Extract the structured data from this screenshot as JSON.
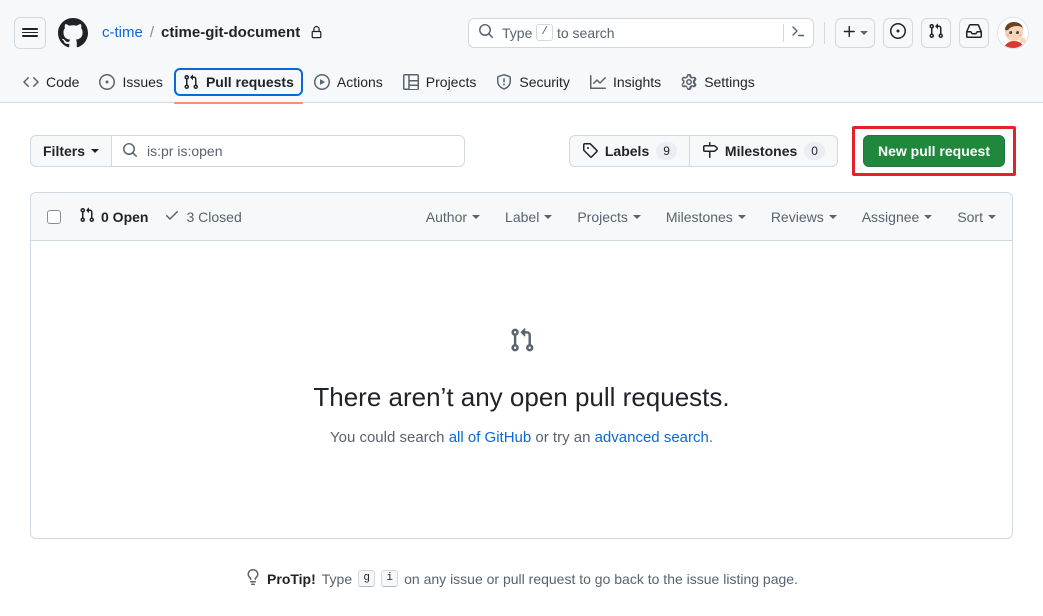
{
  "header": {
    "menu_label": "Open global navigation menu",
    "logo_name": "github-logo",
    "breadcrumb": {
      "owner": "c-time",
      "separator": "/",
      "repo": "ctime-git-document",
      "visibility_icon": "lock-icon"
    },
    "search": {
      "placeholder_before": "Type",
      "placeholder_key": "/",
      "placeholder_after": "to search",
      "terminal_icon": "command-palette-icon"
    },
    "actions": [
      {
        "name": "create-new-menu",
        "icon": "plus-icon",
        "has_caret": true
      },
      {
        "name": "issues-link",
        "icon": "issue-opened-icon"
      },
      {
        "name": "pull-requests-link",
        "icon": "git-pull-request-icon"
      },
      {
        "name": "notifications-inbox",
        "icon": "inbox-icon"
      }
    ],
    "avatar_alt": "user-avatar"
  },
  "nav": {
    "items": [
      {
        "label": "Code",
        "icon": "code-icon",
        "active": false
      },
      {
        "label": "Issues",
        "icon": "issue-opened-icon",
        "active": false
      },
      {
        "label": "Pull requests",
        "icon": "git-pull-request-icon",
        "active": true
      },
      {
        "label": "Actions",
        "icon": "play-icon",
        "active": false
      },
      {
        "label": "Projects",
        "icon": "table-icon",
        "active": false
      },
      {
        "label": "Security",
        "icon": "shield-icon",
        "active": false
      },
      {
        "label": "Insights",
        "icon": "graph-icon",
        "active": false
      },
      {
        "label": "Settings",
        "icon": "gear-icon",
        "active": false
      }
    ]
  },
  "toolbar": {
    "filters_label": "Filters",
    "query_value": "is:pr is:open",
    "search_icon": "search-icon",
    "labels_label": "Labels",
    "labels_count": "9",
    "labels_icon": "tag-icon",
    "milestones_label": "Milestones",
    "milestones_count": "0",
    "milestones_icon": "milestone-icon",
    "new_pr_label": "New pull request",
    "new_pr_highlighted": true
  },
  "list": {
    "select_all_name": "select-all-checkbox",
    "states": [
      {
        "label": "0 Open",
        "icon": "git-pull-request-icon",
        "active": true
      },
      {
        "label": "3 Closed",
        "icon": "check-icon",
        "active": false
      }
    ],
    "filters": [
      "Author",
      "Label",
      "Projects",
      "Milestones",
      "Reviews",
      "Assignee",
      "Sort"
    ],
    "blank": {
      "icon": "git-pull-request-icon",
      "title": "There aren’t any open pull requests.",
      "text_before": "You could search ",
      "link1": "all of GitHub",
      "text_middle": " or try an ",
      "link2": "advanced search",
      "text_after": "."
    }
  },
  "protip": {
    "icon": "light-bulb-icon",
    "label": "ProTip!",
    "text_before": "Type",
    "key1": "g",
    "key2": "i",
    "text_after": "on any issue or pull request to go back to the issue listing page."
  },
  "colors": {
    "accent": "#0969da",
    "success": "#1f883d",
    "highlight": "#e5222a",
    "active_tab_underline": "#fd8c73",
    "header_bg": "#f6f8fa",
    "border": "#d1d9e0"
  }
}
